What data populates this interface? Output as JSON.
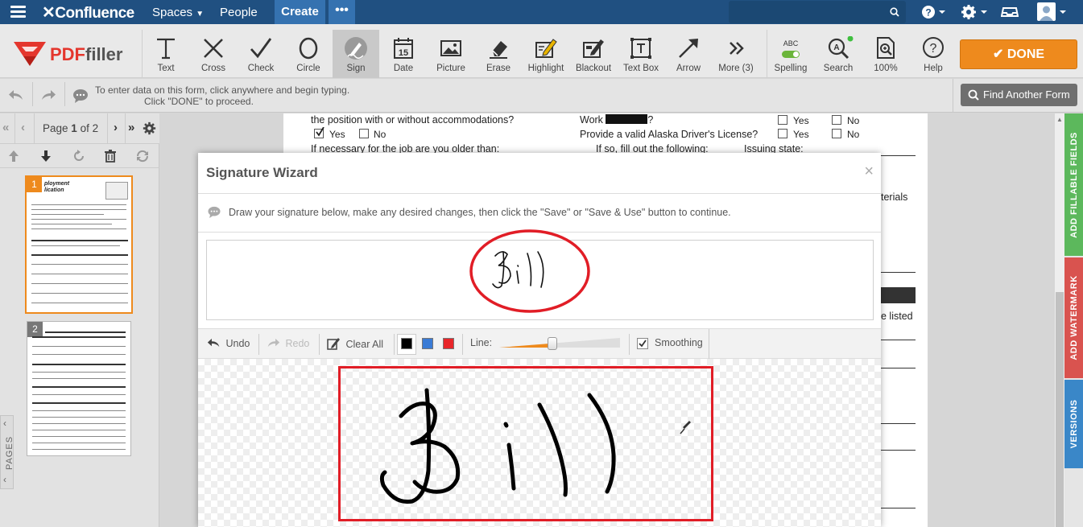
{
  "confluence": {
    "logo": "Confluence",
    "nav_spaces": "Spaces",
    "nav_people": "People",
    "create": "Create",
    "more": "•••",
    "search_placeholder": ""
  },
  "brand": {
    "pre": "PDF",
    "post": "filler"
  },
  "tools": [
    {
      "label": "Text",
      "icon": "text-icon"
    },
    {
      "label": "Cross",
      "icon": "cross-icon"
    },
    {
      "label": "Check",
      "icon": "check-icon"
    },
    {
      "label": "Circle",
      "icon": "circle-icon"
    },
    {
      "label": "Sign",
      "icon": "sign-icon",
      "active": true
    },
    {
      "label": "Date",
      "icon": "calendar-icon",
      "day": "15"
    },
    {
      "label": "Picture",
      "icon": "picture-icon"
    },
    {
      "label": "Erase",
      "icon": "eraser-icon"
    },
    {
      "label": "Highlight",
      "icon": "highlight-icon"
    },
    {
      "label": "Blackout",
      "icon": "blackout-icon"
    },
    {
      "label": "Text Box",
      "icon": "textbox-icon"
    },
    {
      "label": "Arrow",
      "icon": "arrow-icon"
    },
    {
      "label": "More (3)",
      "icon": "more-icon"
    },
    {
      "label": "Spelling",
      "icon": "spelling-icon",
      "badge": "ABC"
    },
    {
      "label": "Search",
      "icon": "search-icon"
    },
    {
      "label": "100%",
      "icon": "zoom-icon"
    },
    {
      "label": "Help",
      "icon": "help-icon"
    }
  ],
  "done_label": "DONE",
  "info": {
    "line1": "To enter data on this form, click anywhere and begin typing.",
    "line2": "Click \"DONE\" to proceed."
  },
  "find_form": "Find Another Form",
  "pager": {
    "prefix": "Page",
    "current": "1",
    "of": "of 2"
  },
  "pages_tab": "PAGES",
  "document": {
    "q1": "the position with or without accommodations?",
    "yes": "Yes",
    "no": "No",
    "work": "Work",
    "qmark": "?",
    "q2": "Provide a valid Alaska Driver's License?",
    "q3": "If necessary for the job are you older than:",
    "q4": "If so, fill out the following:",
    "q5": "Issuing state:",
    "frag1": "terials",
    "frag2": "e listed"
  },
  "right_tabs": {
    "fields": "ADD FILLABLE FIELDS",
    "watermark": "ADD WATERMARK",
    "versions": "VERSIONS"
  },
  "wizard": {
    "title": "Signature Wizard",
    "close": "×",
    "instructions": "Draw your signature below, make any desired changes, then click the \"Save\" or \"Save & Use\" button to continue.",
    "undo": "Undo",
    "redo": "Redo",
    "clear_all": "Clear All",
    "line_label": "Line:",
    "line_value": 0.44,
    "smoothing": "Smoothing",
    "colors": [
      "#000000",
      "#3a7bd5",
      "#e8262a"
    ],
    "selected_color": "#000000",
    "signature_text": "Bill"
  },
  "colors": {
    "confluence": "#205081",
    "done": "#ee8a1d",
    "annotation": "#e11d26"
  }
}
